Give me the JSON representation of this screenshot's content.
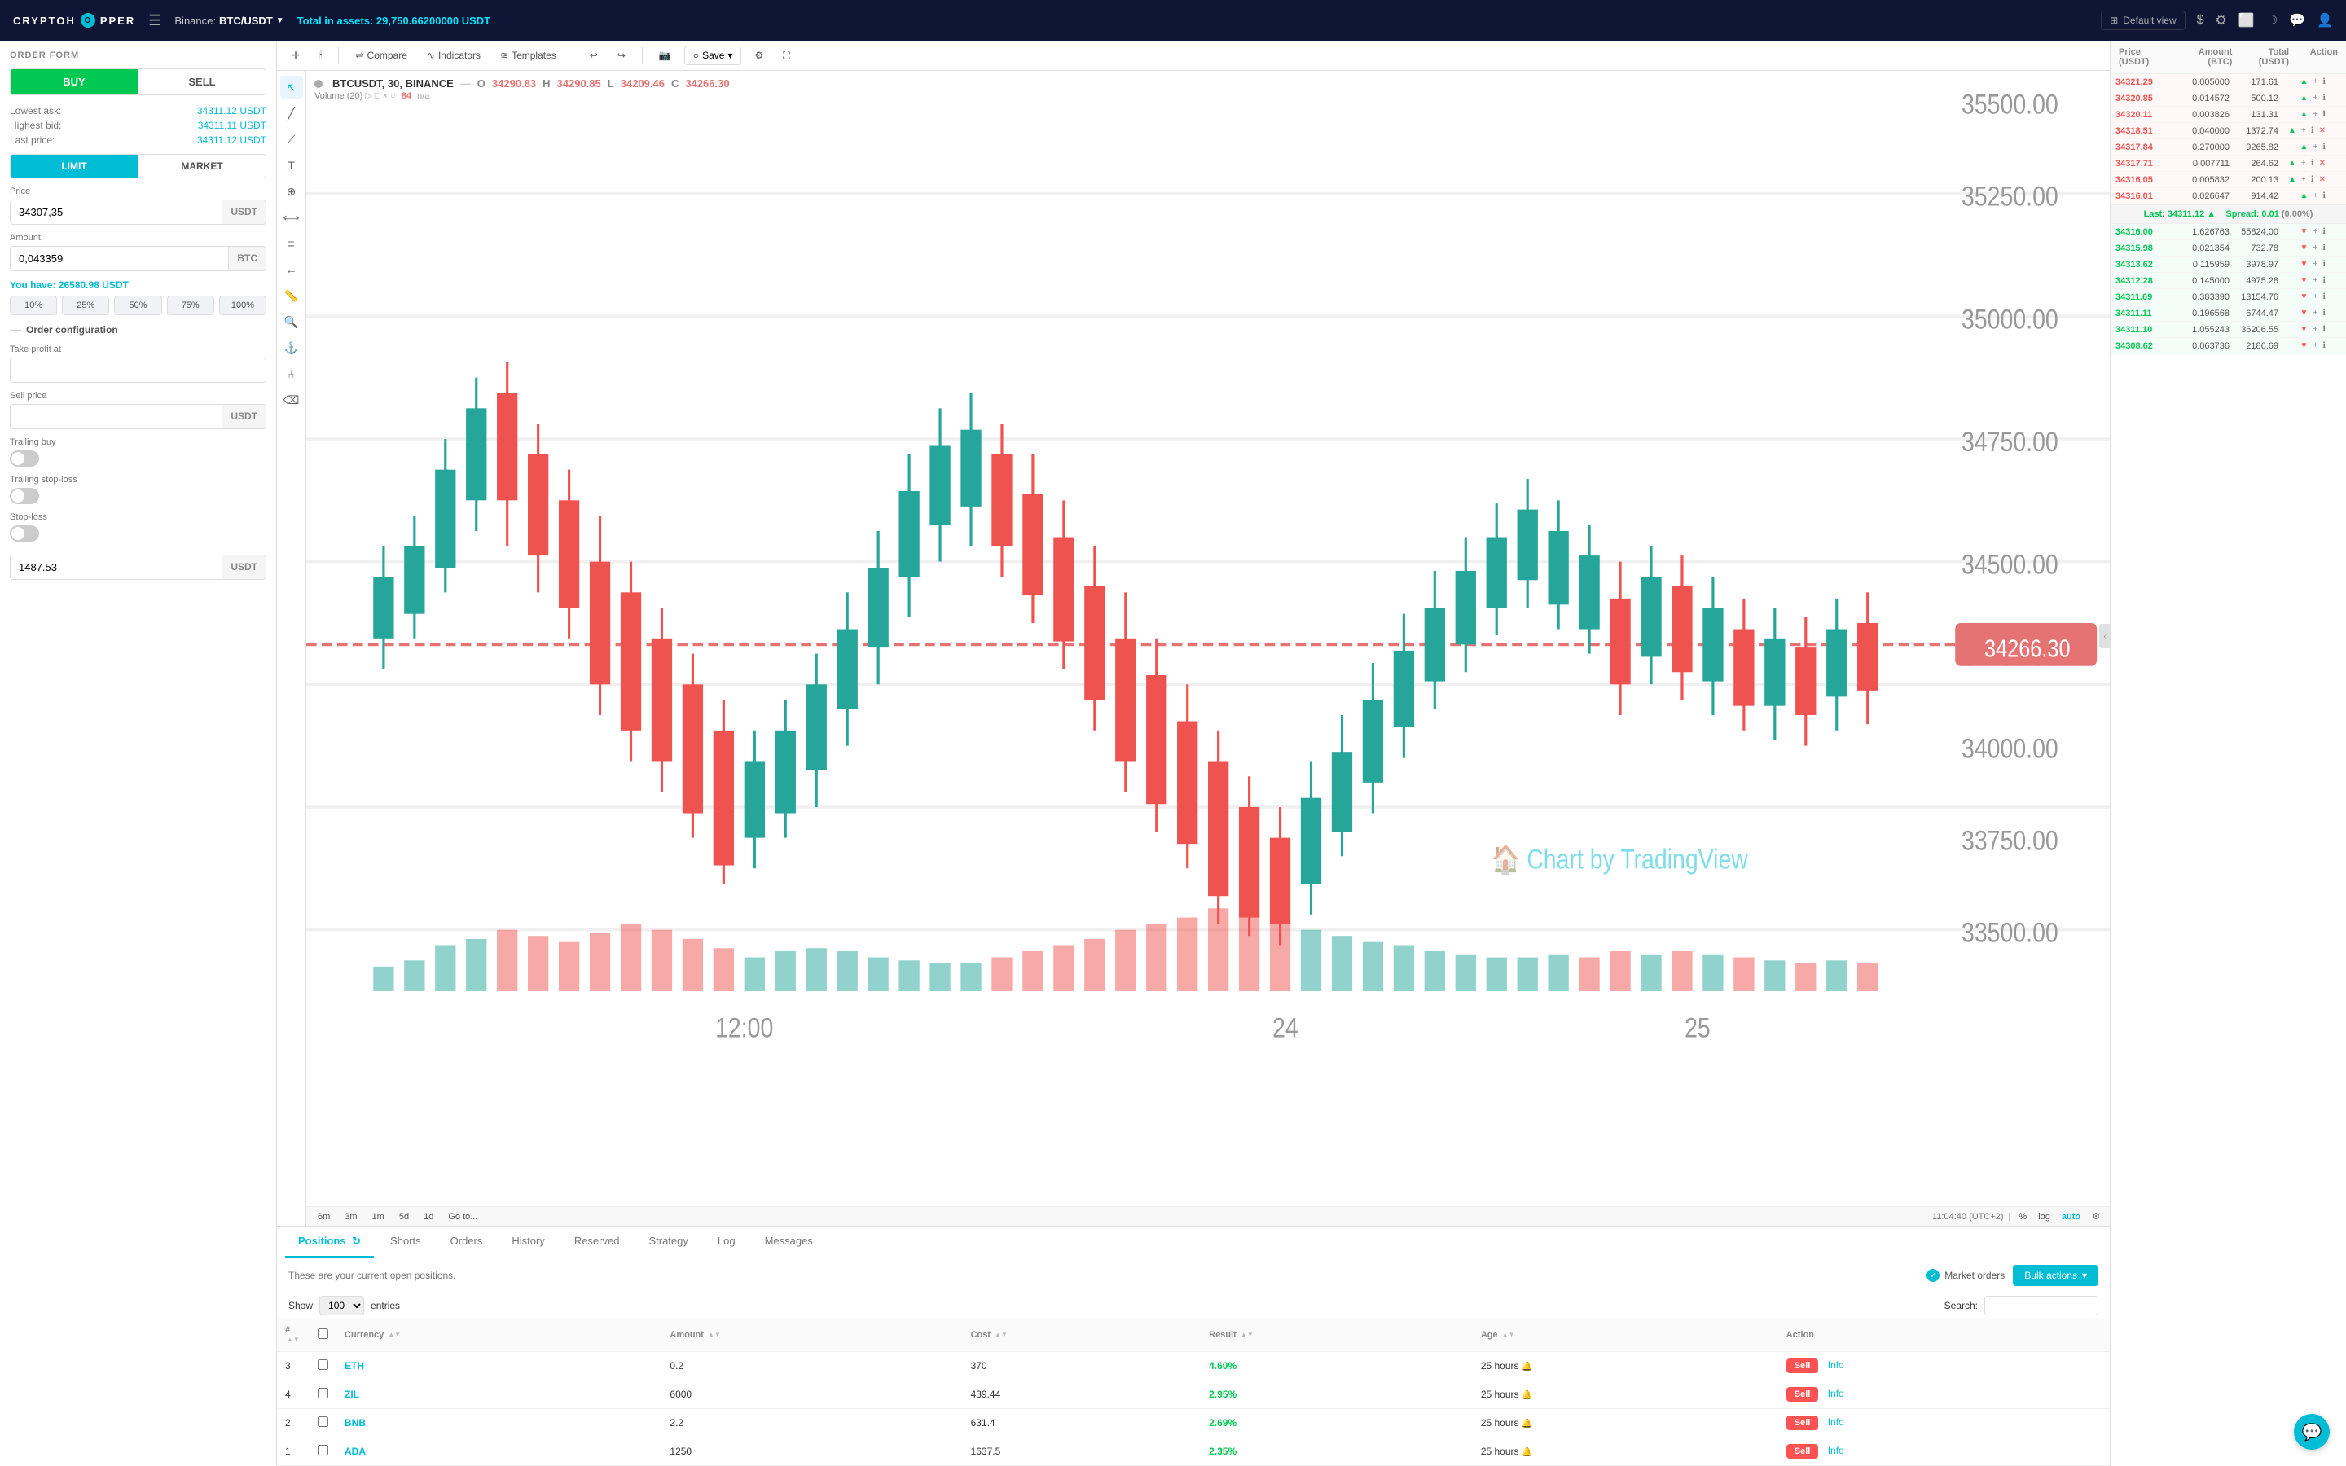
{
  "app": {
    "name": "CRYPTOHOPPER",
    "logo_char": "O"
  },
  "topnav": {
    "pair": "BTC/USDT",
    "exchange": "Binance",
    "total_assets_label": "Total in assets:",
    "total_assets_value": "29,750.66200000 USDT",
    "default_view_label": "Default view"
  },
  "order_form": {
    "title": "ORDER FORM",
    "buy_label": "BUY",
    "sell_label": "SELL",
    "lowest_ask_label": "Lowest ask:",
    "lowest_ask_value": "34311.12",
    "lowest_ask_unit": "USDT",
    "highest_bid_label": "Highest bid:",
    "highest_bid_value": "34311.11",
    "highest_bid_unit": "USDT",
    "last_price_label": "Last price:",
    "last_price_value": "34311.12",
    "last_price_unit": "USDT",
    "limit_label": "LIMIT",
    "market_label": "MARKET",
    "price_label": "Price",
    "price_value": "34307,35",
    "price_unit": "USDT",
    "amount_label": "Amount",
    "amount_value": "0,043359",
    "amount_unit": "BTC",
    "you_have_label": "You have:",
    "you_have_value": "26580.98",
    "you_have_unit": "USDT",
    "pct_10": "10%",
    "pct_25": "25%",
    "pct_50": "50%",
    "pct_75": "75%",
    "pct_100": "100%",
    "order_config_label": "Order configuration",
    "take_profit_label": "Take profit at",
    "sell_price_label": "Sell price",
    "sell_price_unit": "USDT",
    "trailing_buy_label": "Trailing buy",
    "trailing_stop_loss_label": "Trailing stop-loss",
    "stop_loss_label": "Stop-loss",
    "bottom_value": "1487.53",
    "bottom_unit": "USDT"
  },
  "chart": {
    "timeframe": "30m",
    "compare_label": "Compare",
    "indicators_label": "Indicators",
    "templates_label": "Templates",
    "save_label": "Save",
    "pair": "BTCUSDT, 30, BINANCE",
    "open": "34290.83",
    "high": "34290.85",
    "low": "34209.46",
    "close": "34266.30",
    "volume": "20",
    "vol_value": "84",
    "vol_suffix": "n/a",
    "timeframes": [
      "6m",
      "3m",
      "1m",
      "5d",
      "1d"
    ],
    "goto_label": "Go to...",
    "time_label": "11:04:40 (UTC+2)",
    "pct_label": "%",
    "log_label": "log",
    "auto_label": "auto"
  },
  "bottom_tabs": {
    "positions_label": "Positions",
    "shorts_label": "Shorts",
    "orders_label": "Orders",
    "history_label": "History",
    "reserved_label": "Reserved",
    "strategy_label": "Strategy",
    "log_label": "Log",
    "messages_label": "Messages"
  },
  "positions": {
    "info_text": "These are your current open positions.",
    "market_orders_label": "Market orders",
    "bulk_actions_label": "Bulk actions",
    "show_label": "Show",
    "show_count": "100",
    "entries_label": "entries",
    "search_label": "Search:",
    "search_placeholder": "",
    "columns": {
      "num": "#",
      "currency": "Currency",
      "amount": "Amount",
      "cost": "Cost",
      "result": "Result",
      "age": "Age",
      "action": "Action"
    },
    "rows": [
      {
        "num": "3",
        "currency": "ETH",
        "amount": "0.2",
        "cost": "370",
        "result": "4.60%",
        "age": "25 hours",
        "sell_label": "Sell",
        "info_label": "Info"
      },
      {
        "num": "4",
        "currency": "ZIL",
        "amount": "6000",
        "cost": "439.44",
        "result": "2.95%",
        "age": "25 hours",
        "sell_label": "Sell",
        "info_label": "Info"
      },
      {
        "num": "2",
        "currency": "BNB",
        "amount": "2.2",
        "cost": "631.4",
        "result": "2.69%",
        "age": "25 hours",
        "sell_label": "Sell",
        "info_label": "Info"
      },
      {
        "num": "1",
        "currency": "ADA",
        "amount": "1250",
        "cost": "1637.5",
        "result": "2.35%",
        "age": "25 hours",
        "sell_label": "Sell",
        "info_label": "Info"
      }
    ]
  },
  "orderbook": {
    "col_price": "Price\n(USDT)",
    "col_amount": "Amount\n(BTC)",
    "col_total": "Total\n(USDT)",
    "col_action": "Action",
    "spread_label": "Spread:",
    "spread_value": "0.01",
    "spread_pct": "(0.00%)",
    "last_label": "Last",
    "last_value": "34311.12",
    "asks": [
      {
        "price": "34321.29",
        "amount": "0.005000",
        "total": "171.61"
      },
      {
        "price": "34320.85",
        "amount": "0.014572",
        "total": "500.12"
      },
      {
        "price": "34320.11",
        "amount": "0.003826",
        "total": "131.31"
      },
      {
        "price": "34318.51",
        "amount": "0.040000",
        "total": "1372.74"
      },
      {
        "price": "34317.84",
        "amount": "0.270000",
        "total": "9265.82"
      },
      {
        "price": "34317.71",
        "amount": "0.007711",
        "total": "264.62"
      },
      {
        "price": "34316.05",
        "amount": "0.005832",
        "total": "200.13"
      },
      {
        "price": "34316.01",
        "amount": "0.026647",
        "total": "914.42"
      }
    ],
    "bids": [
      {
        "price": "34316.00",
        "amount": "1.626763",
        "total": "55824.00"
      },
      {
        "price": "34315.98",
        "amount": "0.021354",
        "total": "732.78"
      },
      {
        "price": "34313.62",
        "amount": "0.115959",
        "total": "3978.97"
      },
      {
        "price": "34312.28",
        "amount": "0.145000",
        "total": "4975.28"
      },
      {
        "price": "34311.69",
        "amount": "0.383390",
        "total": "13154.76"
      },
      {
        "price": "34311.11",
        "amount": "0.196568",
        "total": "6744.47"
      },
      {
        "price": "34311.10",
        "amount": "1.055243",
        "total": "36206.55"
      },
      {
        "price": "34308.62",
        "amount": "0.063736",
        "total": "2186.69"
      }
    ]
  }
}
